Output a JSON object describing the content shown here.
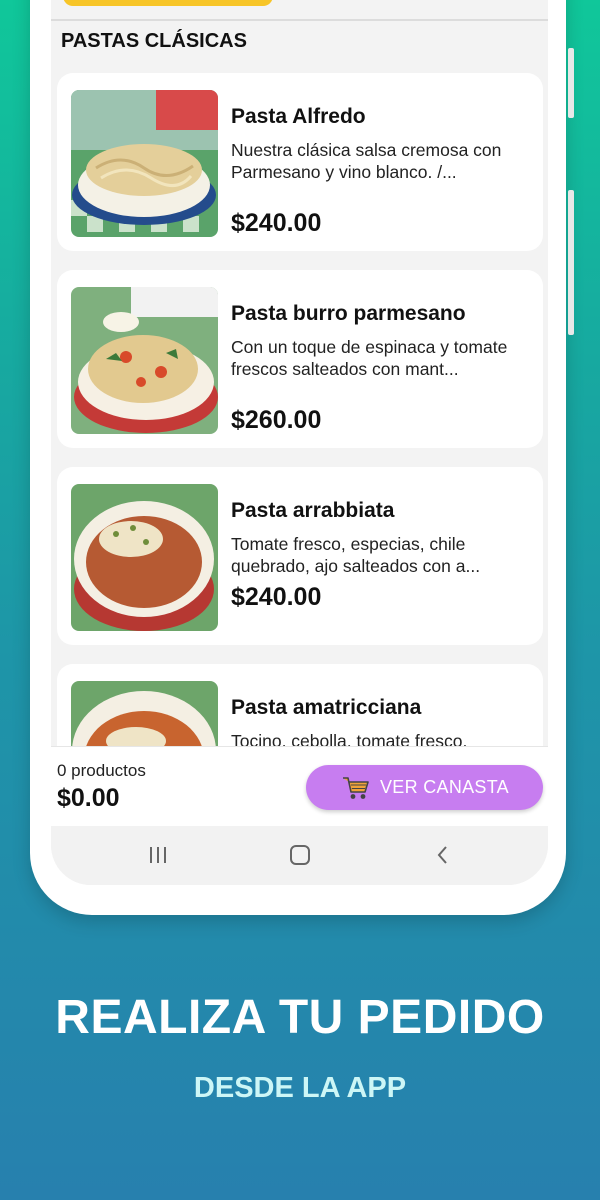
{
  "section_title": "PASTAS CLÁSICAS",
  "products": [
    {
      "name": "Pasta Alfredo",
      "description": "Nuestra clásica salsa cremosa con Parmesano y vino blanco. /...",
      "price": "$240.00"
    },
    {
      "name": "Pasta burro parmesano",
      "description": "Con un toque de espinaca y tomate frescos salteados con mant...",
      "price": "$260.00"
    },
    {
      "name": "Pasta arrabbiata",
      "description": "Tomate fresco, especias, chile quebrado, ajo salteados con a...",
      "price": "$240.00"
    },
    {
      "name": "Pasta amatricciana",
      "description": "Tocino, cebolla, tomate fresco,",
      "price": ""
    }
  ],
  "cart": {
    "count_label": "0 productos",
    "total": "$0.00",
    "button_label": "VER CANASTA"
  },
  "promo": {
    "headline": "REALIZA TU PEDIDO",
    "subline": "DESDE LA APP"
  },
  "colors": {
    "accent_button": "#c77df0",
    "top_pill": "#f7c528",
    "background_top": "#10c79a",
    "background_bottom": "#2780ae"
  },
  "icons": [
    "cart-icon",
    "recent-apps-icon",
    "home-icon",
    "back-icon"
  ]
}
